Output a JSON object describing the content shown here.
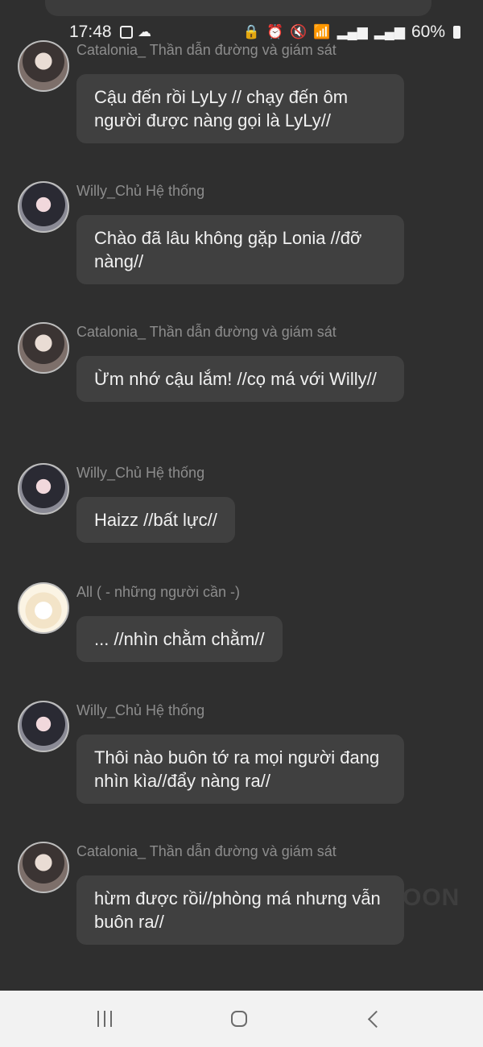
{
  "status_bar": {
    "time": "17:48",
    "battery": "60%",
    "left_icons": [
      "square-notification-icon",
      "cloud-hand-icon"
    ],
    "right_icons": [
      "vpn-lock-icon",
      "alarm-icon",
      "mute-icon",
      "wifi-icon",
      "signal-icon",
      "signal-icon-2"
    ]
  },
  "messages": [
    {
      "sender": "Catalonia_ Thần dẫn đường và giám sát",
      "avatar": "girl-a",
      "text": "Cậu đến rồi LyLy // chạy đến ôm người được nàng gọi là LyLy//"
    },
    {
      "sender": "Willy_Chủ Hệ thống",
      "avatar": "girl-b",
      "text": "Chào đã lâu không gặp Lonia //đỡ nàng//"
    },
    {
      "sender": "Catalonia_ Thần dẫn đường và giám sát",
      "avatar": "girl-a",
      "text": "Ừm nhớ cậu lắm! //cọ má với Willy//"
    },
    {
      "sender": "Willy_Chủ Hệ thống",
      "avatar": "girl-b",
      "text": "Haizz //bất lực//"
    },
    {
      "sender": "All ( - những người cần -)",
      "avatar": "cat",
      "text": "... //nhìn chằm chằm//"
    },
    {
      "sender": "Willy_Chủ Hệ thống",
      "avatar": "girl-b",
      "text": "Thôi nào buôn tớ ra mọi người đang nhìn kìa//đẩy nàng ra//"
    },
    {
      "sender": "Catalonia_ Thần dẫn đường và giám sát",
      "avatar": "girl-a",
      "text": "hừm được rồi//phòng má nhưng vẫn buôn ra//"
    }
  ],
  "watermark": "OON",
  "nav": {
    "recent": "recent-apps-icon",
    "home": "home-icon",
    "back": "back-icon"
  }
}
